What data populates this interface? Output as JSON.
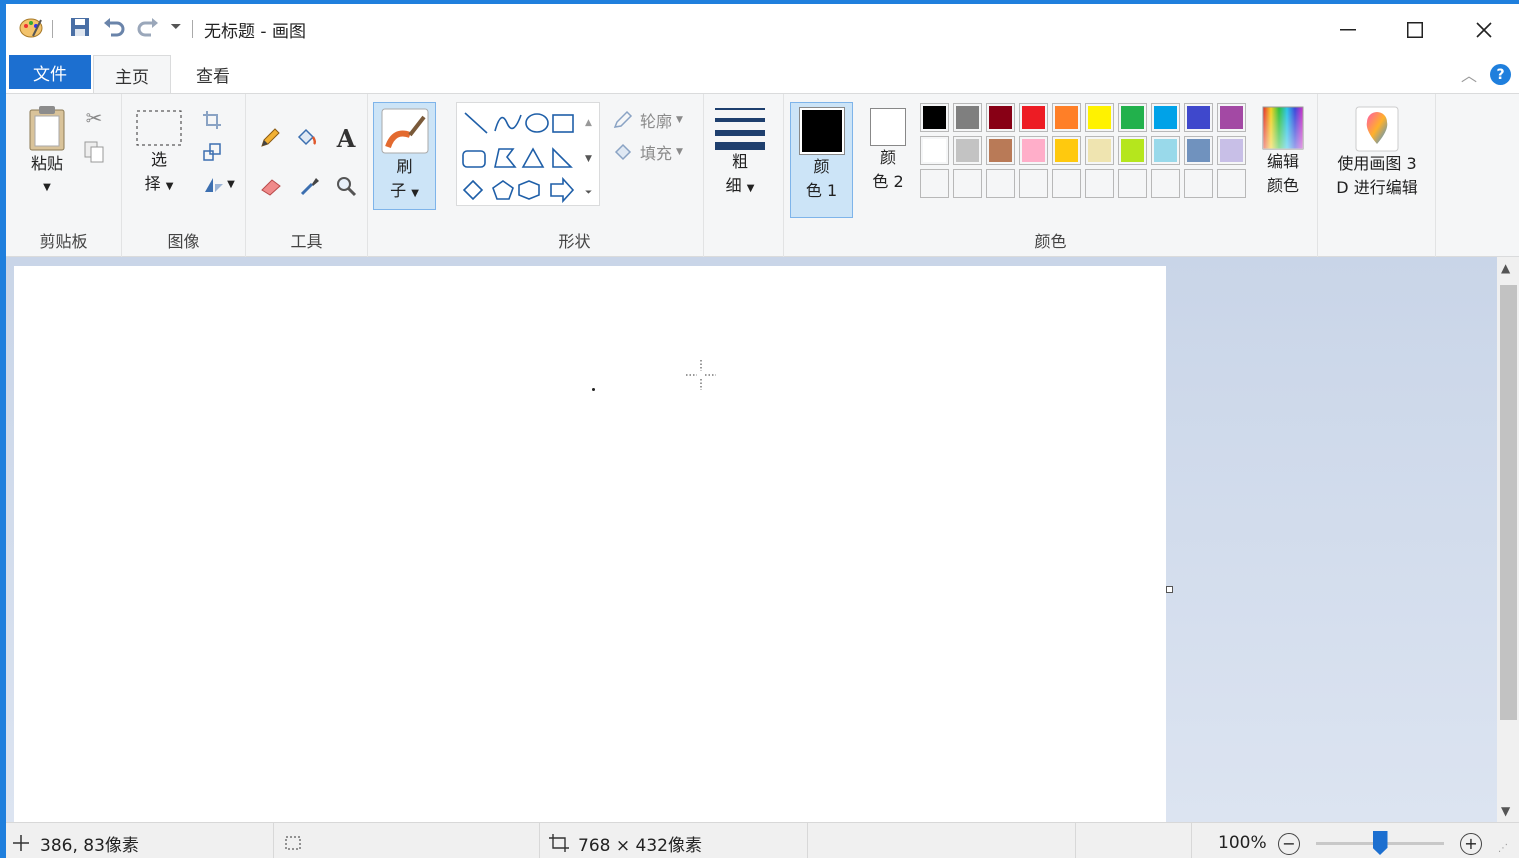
{
  "window": {
    "title": "无标题 - 画图",
    "accent": "#1f7fdd"
  },
  "tabs": {
    "file": "文件",
    "home": "主页",
    "view": "查看"
  },
  "ribbon": {
    "clipboard": {
      "paste": "粘贴",
      "group": "剪贴板"
    },
    "image": {
      "select_line1": "选",
      "select_line2": "择",
      "group": "图像"
    },
    "tools": {
      "group": "工具"
    },
    "brushes": {
      "line1": "刷",
      "line2": "子"
    },
    "shapes": {
      "outline": "轮廓",
      "fill": "填充",
      "group": "形状"
    },
    "size": {
      "line1": "粗",
      "line2": "细"
    },
    "colors": {
      "color1_line1": "颜",
      "color1_line2": "色 1",
      "color2_line1": "颜",
      "color2_line2": "色 2",
      "edit_line1": "编辑",
      "edit_line2": "颜色",
      "group": "颜色",
      "color1": "#000000",
      "color2": "#ffffff",
      "palette_row1": [
        "#000000",
        "#7f7f7f",
        "#880015",
        "#ed1c24",
        "#ff7f27",
        "#fff200",
        "#22b14c",
        "#00a2e8",
        "#3f48cc",
        "#a349a4"
      ],
      "palette_row2": [
        "#ffffff",
        "#c3c3c3",
        "#b97a57",
        "#ffaec9",
        "#ffc90e",
        "#efe4b0",
        "#b5e61d",
        "#99d9ea",
        "#7092be",
        "#c8bfe7"
      ]
    },
    "paint3d": {
      "line1": "使用画图 3",
      "line2": "D 进行编辑"
    }
  },
  "status": {
    "cursor_pos": "386, 83像素",
    "canvas_size": "768 × 432像素",
    "zoom": "100%",
    "zoom_fraction": 0.5
  }
}
